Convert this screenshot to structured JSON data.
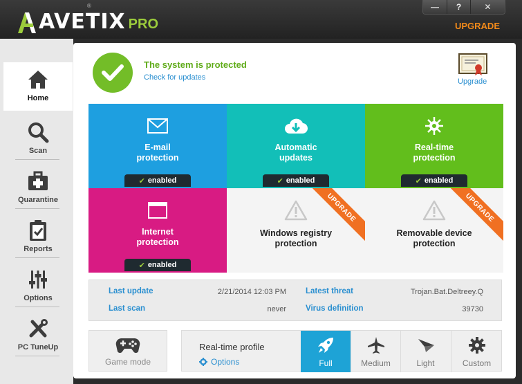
{
  "app": {
    "brand": "AVETIX",
    "edition": "PRO",
    "registered": "®",
    "window_controls": {
      "minimize": "—",
      "help": "?",
      "close": "✕"
    },
    "upgrade_top": "UPGRADE"
  },
  "sidebar": {
    "items": [
      {
        "label": "Home",
        "icon": "home-icon",
        "active": true
      },
      {
        "label": "Scan",
        "icon": "magnifier-icon",
        "active": false
      },
      {
        "label": "Quarantine",
        "icon": "medkit-icon",
        "active": false
      },
      {
        "label": "Reports",
        "icon": "clipboard-icon",
        "active": false
      },
      {
        "label": "Options",
        "icon": "sliders-icon",
        "active": false
      },
      {
        "label": "PC TuneUp",
        "icon": "tools-icon",
        "active": false
      }
    ]
  },
  "status": {
    "title": "The system is protected",
    "link": "Check for updates",
    "upgrade_label": "Upgrade"
  },
  "tiles": [
    {
      "label_line1": "E-mail",
      "label_line2": "protection",
      "state": "enabled",
      "color": "#1e9fe0",
      "icon": "envelope-icon"
    },
    {
      "label_line1": "Automatic",
      "label_line2": "updates",
      "state": "enabled",
      "color": "#12bfb8",
      "icon": "cloud-download-icon"
    },
    {
      "label_line1": "Real-time",
      "label_line2": "protection",
      "state": "enabled",
      "color": "#62be1c",
      "icon": "virus-icon"
    },
    {
      "label_line1": "Internet",
      "label_line2": "protection",
      "state": "enabled",
      "color": "#d81b83",
      "icon": "browser-window-icon"
    },
    {
      "label_line1": "Windows registry",
      "label_line2": "protection",
      "ribbon": "UPGRADE",
      "icon": "warning-icon"
    },
    {
      "label_line1": "Removable device",
      "label_line2": "protection",
      "ribbon": "UPGRADE",
      "icon": "warning-icon"
    }
  ],
  "info": {
    "last_update_label": "Last update",
    "last_update_value": "2/21/2014 12:03 PM",
    "last_scan_label": "Last scan",
    "last_scan_value": "never",
    "latest_threat_label": "Latest threat",
    "latest_threat_value": "Trojan.Bat.Deltreey.Q",
    "virus_def_label": "Virus definition",
    "virus_def_value": "39730"
  },
  "game_mode": {
    "label": "Game mode"
  },
  "profile": {
    "title": "Real-time profile",
    "options_label": "Options",
    "buttons": [
      {
        "label": "Full",
        "icon": "rocket-icon",
        "active": true
      },
      {
        "label": "Medium",
        "icon": "airplane-icon",
        "active": false
      },
      {
        "label": "Light",
        "icon": "paper-plane-icon",
        "active": false
      },
      {
        "label": "Custom",
        "icon": "gear-icon",
        "active": false
      }
    ]
  },
  "colors": {
    "accent_blue": "#2a8fd0",
    "status_green": "#73bd28",
    "upgrade_orange": "#f07022",
    "profile_active": "#1ea3d6"
  }
}
